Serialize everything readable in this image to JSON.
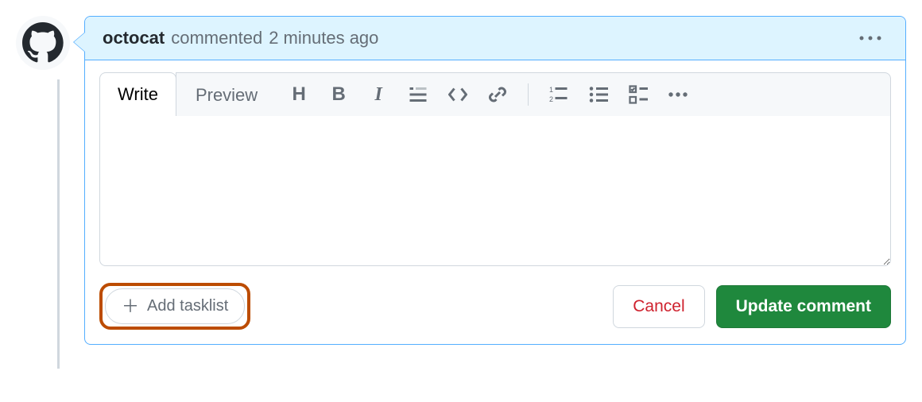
{
  "author": "octocat",
  "comment_meta_prefix": "commented",
  "comment_time": "2 minutes ago",
  "tabs": {
    "write": "Write",
    "preview": "Preview"
  },
  "toolbar": {
    "heading": "Heading",
    "bold": "Bold",
    "italic": "Italic",
    "quote": "Quote",
    "code": "Code",
    "link": "Link",
    "ordered_list": "Ordered list",
    "unordered_list": "Unordered list",
    "task_list": "Task list",
    "more": "More"
  },
  "textarea": {
    "value": "",
    "placeholder": ""
  },
  "actions": {
    "add_tasklist": "Add tasklist",
    "cancel": "Cancel",
    "update": "Update comment"
  },
  "colors": {
    "accent_blue_bg": "#ddf4ff",
    "accent_blue_border": "#54aeff",
    "highlight_orange": "#bc4c00",
    "primary_green": "#1f883d",
    "danger_red": "#cf222e"
  }
}
